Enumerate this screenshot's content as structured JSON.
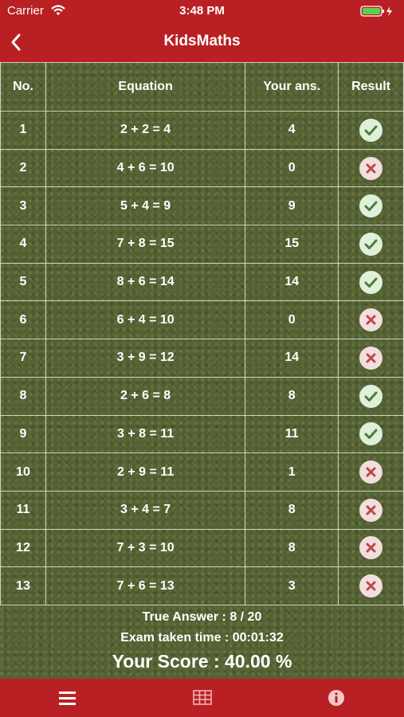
{
  "status": {
    "carrier": "Carrier",
    "time": "3:48 PM"
  },
  "nav": {
    "title": "KidsMaths"
  },
  "table": {
    "headers": [
      "No.",
      "Equation",
      "Your ans.",
      "Result"
    ],
    "rows": [
      {
        "no": "1",
        "equation": "2 + 2 = 4",
        "answer": "4",
        "correct": true
      },
      {
        "no": "2",
        "equation": "4 + 6 = 10",
        "answer": "0",
        "correct": false
      },
      {
        "no": "3",
        "equation": "5 + 4 = 9",
        "answer": "9",
        "correct": true
      },
      {
        "no": "4",
        "equation": "7 + 8 = 15",
        "answer": "15",
        "correct": true
      },
      {
        "no": "5",
        "equation": "8 + 6 = 14",
        "answer": "14",
        "correct": true
      },
      {
        "no": "6",
        "equation": "6 + 4 = 10",
        "answer": "0",
        "correct": false
      },
      {
        "no": "7",
        "equation": "3 + 9 = 12",
        "answer": "14",
        "correct": false
      },
      {
        "no": "8",
        "equation": "2 + 6 = 8",
        "answer": "8",
        "correct": true
      },
      {
        "no": "9",
        "equation": "3 + 8 = 11",
        "answer": "11",
        "correct": true
      },
      {
        "no": "10",
        "equation": "2 + 9 = 11",
        "answer": "1",
        "correct": false
      },
      {
        "no": "11",
        "equation": "3 + 4 = 7",
        "answer": "8",
        "correct": false
      },
      {
        "no": "12",
        "equation": "7 + 3 = 10",
        "answer": "8",
        "correct": false
      },
      {
        "no": "13",
        "equation": "7 + 6 = 13",
        "answer": "3",
        "correct": false
      }
    ]
  },
  "summary": {
    "true_answer": "True Answer : 8 / 20",
    "exam_time": "Exam taken time : 00:01:32",
    "score": "Your Score : 40.00 %"
  },
  "tabs": {
    "items": [
      "menu-icon",
      "table-grid-icon",
      "info-icon"
    ]
  },
  "colors": {
    "bar": "#b92024",
    "board": "#546231",
    "ok": "#dff0d8",
    "bad": "#f2dede"
  }
}
